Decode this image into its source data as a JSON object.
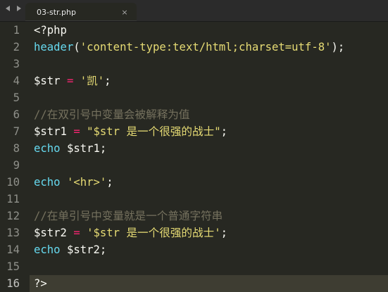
{
  "tabbar": {
    "tab_title": "03-str.php",
    "close_glyph": "×"
  },
  "editor": {
    "line_numbers": [
      "1",
      "2",
      "3",
      "4",
      "5",
      "6",
      "7",
      "8",
      "9",
      "10",
      "11",
      "12",
      "13",
      "14",
      "15",
      "16"
    ],
    "lines": [
      [
        {
          "t": "<?php",
          "c": "plain"
        }
      ],
      [
        {
          "t": "header",
          "c": "func"
        },
        {
          "t": "(",
          "c": "plain"
        },
        {
          "t": "'content-type:text/html;charset=utf-8'",
          "c": "str"
        },
        {
          "t": ");",
          "c": "plain"
        }
      ],
      [],
      [
        {
          "t": "$str",
          "c": "var"
        },
        {
          "t": " ",
          "c": "plain"
        },
        {
          "t": "=",
          "c": "op"
        },
        {
          "t": " ",
          "c": "plain"
        },
        {
          "t": "'凯'",
          "c": "str"
        },
        {
          "t": ";",
          "c": "plain"
        }
      ],
      [],
      [
        {
          "t": "//在双引号中变量会被解释为值",
          "c": "cmt"
        }
      ],
      [
        {
          "t": "$str1",
          "c": "var"
        },
        {
          "t": " ",
          "c": "plain"
        },
        {
          "t": "=",
          "c": "op"
        },
        {
          "t": " ",
          "c": "plain"
        },
        {
          "t": "\"$str 是一个很强的战士\"",
          "c": "str"
        },
        {
          "t": ";",
          "c": "plain"
        }
      ],
      [
        {
          "t": "echo",
          "c": "func"
        },
        {
          "t": " $str1;",
          "c": "plain"
        }
      ],
      [],
      [
        {
          "t": "echo",
          "c": "func"
        },
        {
          "t": " ",
          "c": "plain"
        },
        {
          "t": "'<hr>'",
          "c": "str"
        },
        {
          "t": ";",
          "c": "plain"
        }
      ],
      [],
      [
        {
          "t": "//在单引号中变量就是一个普通字符串",
          "c": "cmt"
        }
      ],
      [
        {
          "t": "$str2",
          "c": "var"
        },
        {
          "t": " ",
          "c": "plain"
        },
        {
          "t": "=",
          "c": "op"
        },
        {
          "t": " ",
          "c": "plain"
        },
        {
          "t": "'$str 是一个很强的战士'",
          "c": "str"
        },
        {
          "t": ";",
          "c": "plain"
        }
      ],
      [
        {
          "t": "echo",
          "c": "func"
        },
        {
          "t": " $str2;",
          "c": "plain"
        }
      ],
      [],
      [
        {
          "t": "?>",
          "c": "plain"
        }
      ]
    ],
    "current_line_index": 15
  },
  "colors": {
    "background": "#272822",
    "plain": "#f8f8f2",
    "function": "#66d9ef",
    "string": "#e6db74",
    "operator": "#f92672",
    "comment": "#75715e"
  },
  "icons": {
    "nav_back": "triangle-left-icon",
    "nav_forward": "triangle-right-icon",
    "tab_close": "close-icon"
  }
}
